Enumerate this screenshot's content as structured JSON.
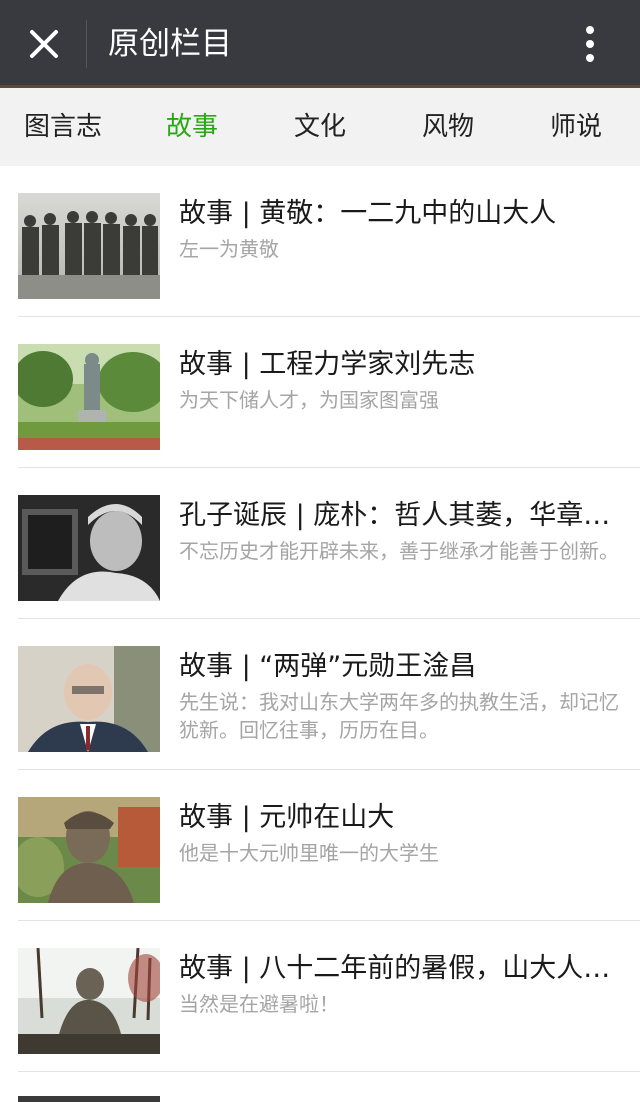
{
  "header": {
    "title": "原创栏目"
  },
  "tabs": [
    {
      "label": "图言志"
    },
    {
      "label": "故事",
      "active": true
    },
    {
      "label": "文化"
    },
    {
      "label": "风物"
    },
    {
      "label": "师说"
    }
  ],
  "articles": [
    {
      "title": "故事 | 黄敬：一二九中的山大人",
      "desc": "左一为黄敬"
    },
    {
      "title": "故事 | 工程力学家刘先志",
      "desc": "为天下储人才，为国家图富强"
    },
    {
      "title": "孔子诞辰 | 庞朴：哲人其萎，华章永存",
      "desc": "不忘历史才能开辟未来，善于继承才能善于创新。"
    },
    {
      "title": "故事 | “两弹”元勋王淦昌",
      "desc": "先生说：我对山东大学两年多的执教生活，却记忆犹新。回忆往事，历历在目。"
    },
    {
      "title": "故事 | 元帅在山大",
      "desc": "他是十大元帅里唯一的大学生"
    },
    {
      "title": "故事 | 八十二年前的暑假，山大人在哪里",
      "desc": "当然是在避暑啦！"
    }
  ],
  "colors": {
    "active_tab": "#2aa715",
    "topbar": "#393a3f"
  }
}
